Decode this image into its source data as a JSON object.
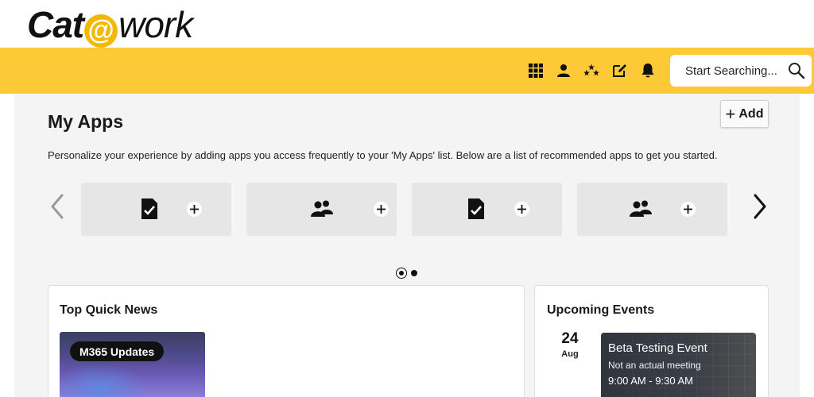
{
  "logo": {
    "part1": "Cat",
    "at": "@",
    "part2": "work"
  },
  "header": {
    "icons": [
      "apps-grid-icon",
      "person-icon",
      "favorites-stars-icon",
      "edit-note-icon",
      "bell-icon"
    ],
    "search": {
      "placeholder": "Start Searching..."
    }
  },
  "my_apps": {
    "title": "My Apps",
    "add_label": "Add",
    "description": "Personalize your experience by adding apps you access frequently to your 'My Apps' list. Below are a list of recommended apps to get you started.",
    "apps": [
      {
        "icon": "document-check-icon"
      },
      {
        "icon": "people-group-icon"
      },
      {
        "icon": "document-check-icon"
      },
      {
        "icon": "people-group-icon"
      }
    ],
    "pagination": {
      "pages": 2,
      "current": 1
    }
  },
  "news": {
    "title": "Top Quick News",
    "items": [
      {
        "tag": "M365 Updates"
      }
    ]
  },
  "events": {
    "title": "Upcoming Events",
    "items": [
      {
        "day": "24",
        "month": "Aug",
        "title": "Beta Testing Event",
        "subtitle": "Not an actual meeting",
        "time": "9:00 AM - 9:30 AM"
      }
    ]
  },
  "colors": {
    "accent": "#fdc937",
    "logo_at": "#f5b800",
    "panel_bg": "#f4f4f4",
    "card_bg": "#e6e6e6"
  }
}
